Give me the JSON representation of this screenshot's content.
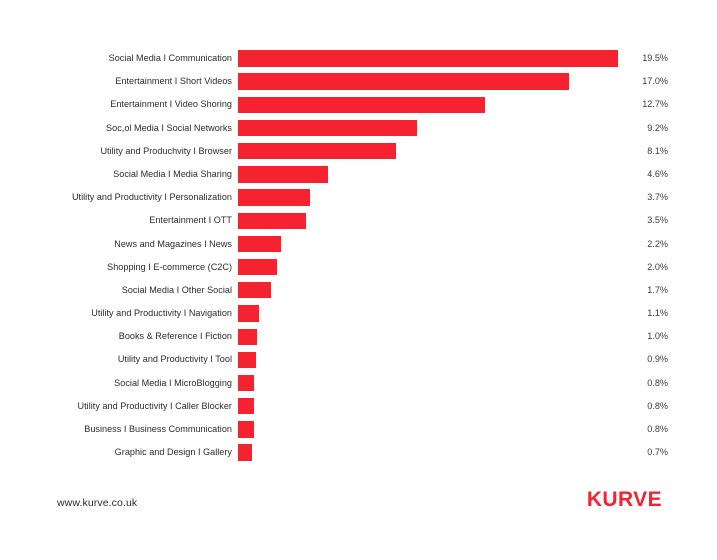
{
  "footer": {
    "site_url": "www.kurve.co.uk",
    "brand": "KURVE"
  },
  "theme": {
    "bar_color": "#f4232f",
    "brand_color": "#f4232f",
    "label_color": "#2b2b2b",
    "value_color": "#3a3a3a",
    "background": "#ffffff"
  },
  "chart_data": {
    "type": "bar",
    "orientation": "horizontal",
    "title": "",
    "subtitle": "",
    "xlabel": "",
    "ylabel": "",
    "grid": false,
    "legend": false,
    "value_suffix": "%",
    "xlim": [
      0,
      19.5
    ],
    "categories": [
      "Social Media I Communication",
      "Entertainment I Short Videos",
      "Entertainment I Video Shoring",
      "Soc,ol Media I Social Networks",
      "Utility and Produchvity I Browser",
      "Social Media I Media Sharing",
      "Utility and Productivity I Personalization",
      "Entertainment I OTT",
      "News and Magazines I News",
      "Shopping I E-commerce (C2C)",
      "Social Media I Other Social",
      "Utility and Productivity I Navigation",
      "Books & Reference I Fiction",
      "Utility and Productivity I Tool",
      "Social Media I MicroBlogging",
      "Utility and Productivity I Caller Blocker",
      "Business I Business Communication",
      "Graphic and Design I Gallery"
    ],
    "values": [
      19.5,
      17.0,
      12.7,
      9.2,
      8.1,
      4.6,
      3.7,
      3.5,
      2.2,
      2.0,
      1.7,
      1.1,
      1.0,
      0.9,
      0.8,
      0.8,
      0.8,
      0.7
    ],
    "value_labels": [
      "19.5%",
      "17.0%",
      "12.7%",
      "9.2%",
      "8.1%",
      "4.6%",
      "3.7%",
      "3.5%",
      "2.2%",
      "2.0%",
      "1.7%",
      "1.1%",
      "1.0%",
      "0.9%",
      "0.8%",
      "0.8%",
      "0.8%",
      "0.7%"
    ]
  }
}
